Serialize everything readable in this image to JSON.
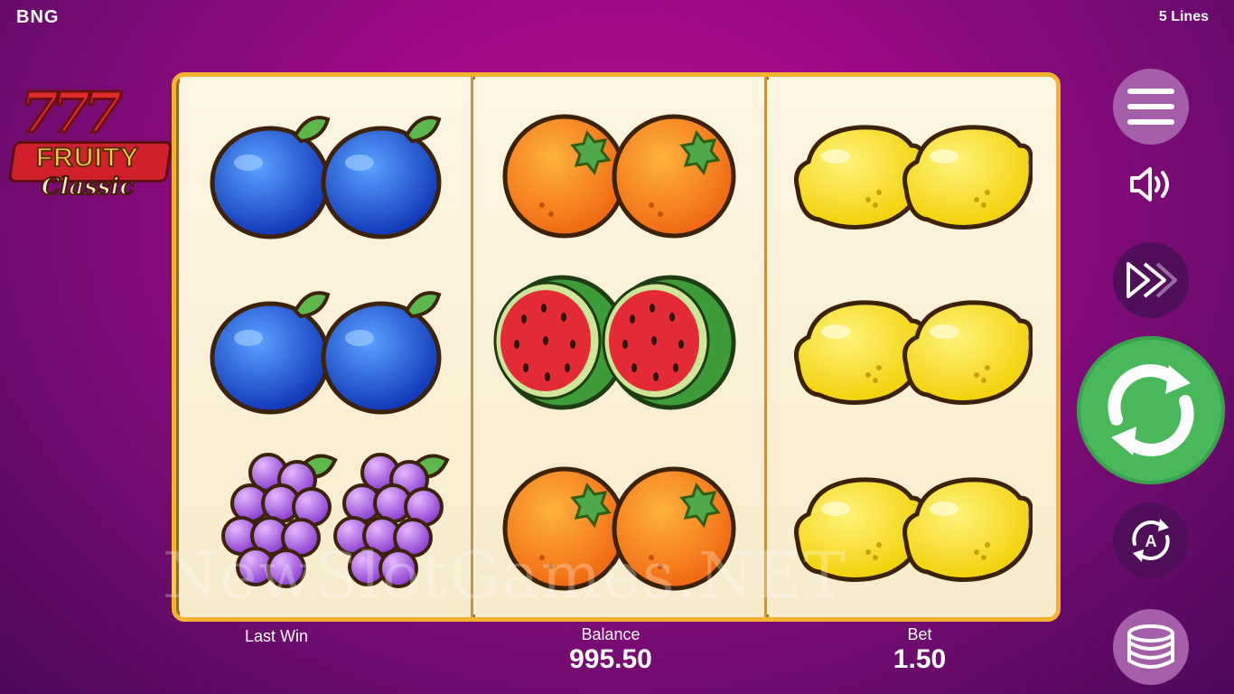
{
  "header": {
    "brand": "BNG",
    "lines_label": "5 Lines"
  },
  "logo": {
    "sevens": "777",
    "line1": "FRUITY",
    "line2": "Classic"
  },
  "reels": [
    [
      "plum",
      "plum",
      "grapes"
    ],
    [
      "orange",
      "watermelon",
      "orange"
    ],
    [
      "lemon",
      "lemon",
      "lemon"
    ]
  ],
  "watermark": "NewSlotGames.NET",
  "stats": {
    "last_win_label": "Last Win",
    "last_win_value": "",
    "balance_label": "Balance",
    "balance_value": "995.50",
    "bet_label": "Bet",
    "bet_value": "1.50"
  },
  "controls": {
    "menu": "menu-icon",
    "sound": "speaker-icon",
    "turbo": "fast-forward-icon",
    "spin": "spin-icon",
    "auto": "autoplay-icon",
    "coins": "coin-stack-icon"
  },
  "colors": {
    "spin": "#48b85b",
    "frame": "#f2b330",
    "background": "#9a0a86"
  }
}
